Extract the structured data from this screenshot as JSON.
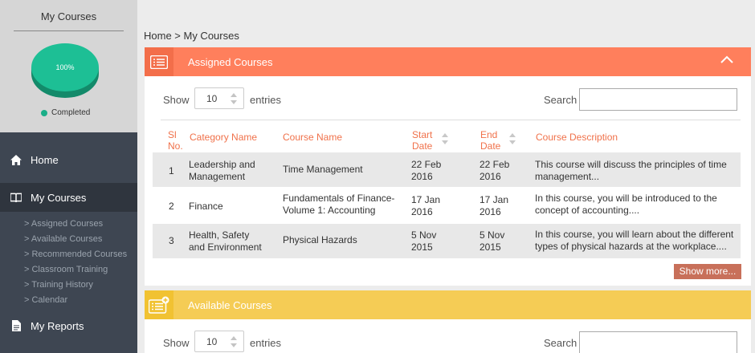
{
  "sidebar": {
    "profile_title": "My Courses",
    "pie_percent_label": "100%",
    "pie_percent": 100,
    "legend_label": "Completed",
    "nav": [
      {
        "label": "Home",
        "icon": "home-icon"
      },
      {
        "label": "My Courses",
        "icon": "book-icon"
      },
      {
        "label": "My Reports",
        "icon": "report-icon"
      }
    ],
    "subnav": [
      "> Assigned Courses",
      "> Available Courses",
      "> Recommended Courses",
      "> Classroom Training",
      "> Training History",
      "> Calendar"
    ]
  },
  "breadcrumb": "Home > My Courses",
  "assigned": {
    "title": "Assigned Courses",
    "color": "#ff7f5c",
    "icon_bg": "#f36e4a",
    "show_label": "Show",
    "entries_value": "10",
    "entries_label": "entries",
    "search_label": "Search",
    "search_value": "",
    "headers": {
      "sl_1": "Sl",
      "sl_2": "No.",
      "category": "Category Name",
      "course": "Course Name",
      "start_1": "Start",
      "start_2": "Date",
      "end_1": "End",
      "end_2": "Date",
      "desc": "Course Description"
    },
    "rows": [
      {
        "no": "1",
        "cat_1": "Leadership and",
        "cat_2": "Management",
        "course_1": "Time Management",
        "course_2": "",
        "start_1": "22 Feb",
        "start_2": "2016",
        "end_1": "22 Feb",
        "end_2": "2016",
        "desc_1": "This course will discuss the principles of time",
        "desc_2": "management..."
      },
      {
        "no": "2",
        "cat_1": "Finance",
        "cat_2": "",
        "course_1": "Fundamentals of Finance-",
        "course_2": "Volume 1: Accounting",
        "start_1": "17 Jan",
        "start_2": "2016",
        "end_1": "17 Jan",
        "end_2": "2016",
        "desc_1": "In this course, you will be introduced to the",
        "desc_2": "concept of accounting...."
      },
      {
        "no": "3",
        "cat_1": "Health, Safety",
        "cat_2": "and Environment",
        "course_1": "Physical Hazards",
        "course_2": "",
        "start_1": "5 Nov",
        "start_2": "2015",
        "end_1": "5 Nov",
        "end_2": "2015",
        "desc_1": "In this course, you will learn about the different",
        "desc_2": "types of physical hazards at the workplace...."
      }
    ],
    "show_more": "Show more..."
  },
  "available": {
    "title": "Available Courses",
    "color": "#f5cc55",
    "icon_bg": "#f1c232",
    "show_label": "Show",
    "entries_value": "10",
    "entries_label": "entries",
    "search_label": "Search",
    "search_value": ""
  }
}
